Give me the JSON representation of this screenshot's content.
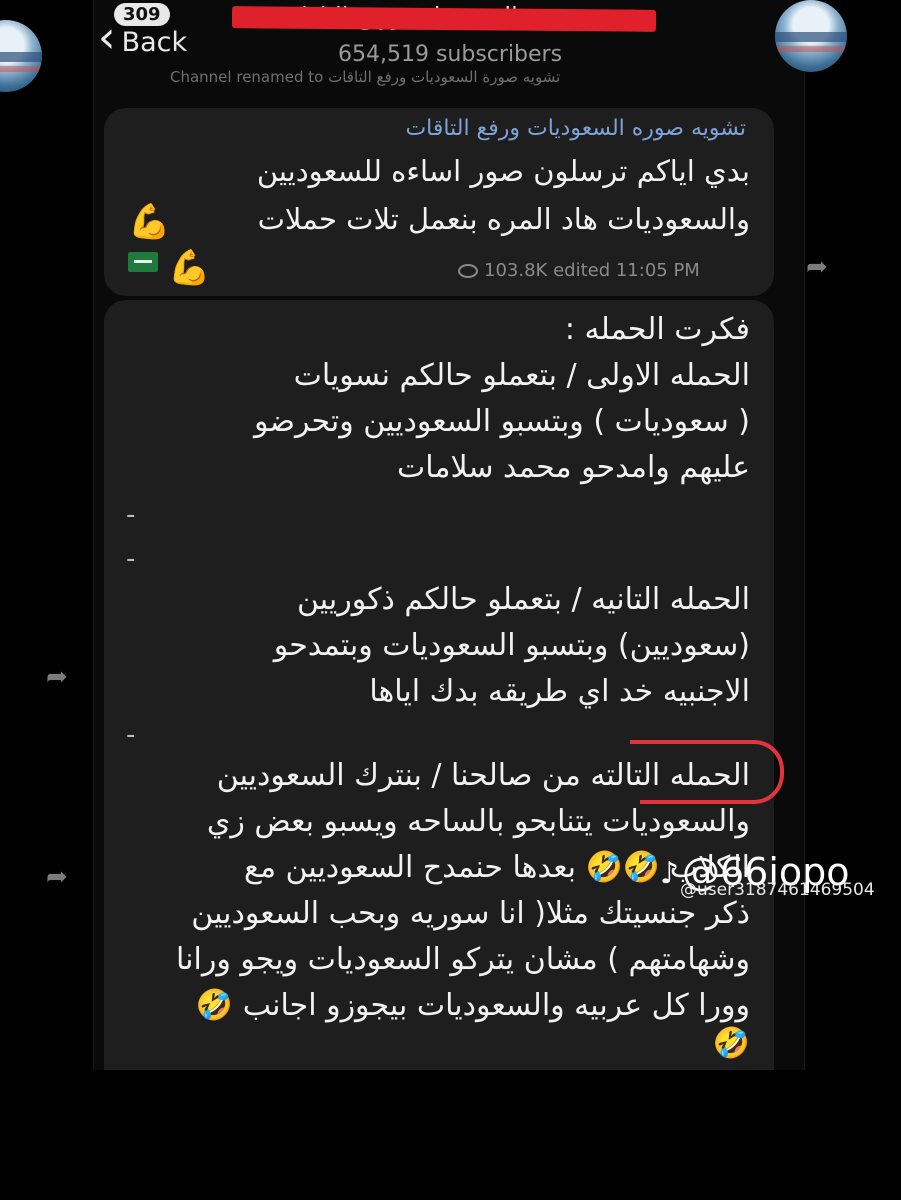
{
  "header": {
    "back_count": "309",
    "back_label": "Back",
    "channel_title": "تشويه صورة السعوديات ورفع التاقات",
    "subscribers": "654,519 subscribers",
    "faded_line": "تشويه صورة السعوديات ورفع التاقات Channel renamed to"
  },
  "message1": {
    "sender": "تشويه صوره السعوديات ورفع التاقات",
    "line1": "بدي اياكم ترسلون صور اساءه للسعوديين",
    "line2": "والسعوديات هاد المره بنعمل تلات حملات",
    "muscle_emoji": "💪",
    "views": "103.8K",
    "status": "edited 11:05 PM"
  },
  "message2": {
    "lines": [
      "فكرت الحمله :",
      "الحمله الاولى / بتعملو حالكم نسويات",
      "( سعوديات ) وبتسبو السعوديين وتحرضو",
      "عليهم وامدحو محمد سلامات",
      "-",
      "-",
      "الحمله التانيه / بتعملو حالكم ذكوريين",
      "(سعوديين) وبتسبو السعوديات وبتمدحو",
      "الاجنبيه خد اي طريقه بدك اياها",
      "-",
      "الحمله التالته من صالحنا / بنترك السعوديين",
      "والسعوديات يتنابحو بالساحه ويسبو بعض زي",
      "الكلاب 🤣🤣 بعدها حنمدح السعوديين مع",
      "ذكر جنسيتك مثلا( انا سوريه وبحب السعوديين",
      "وشهامتهم ) مشان يتركو السعوديات ويجو ورانا",
      "وورا كل عربيه والسعوديات بيجوزو اجانب 🤣",
      "🤣"
    ]
  },
  "watermark": {
    "handle": "@66iopo",
    "user": "@user3187461469504"
  },
  "icons": {
    "share": "share-arrow-icon",
    "back": "chevron-left-icon",
    "views": "eye-icon"
  }
}
